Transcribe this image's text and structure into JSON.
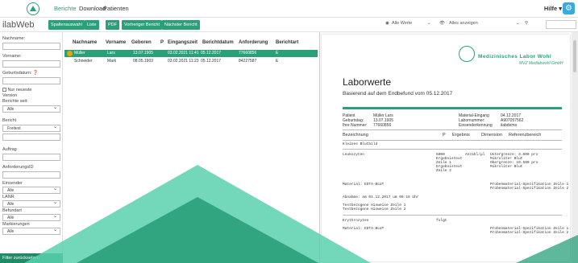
{
  "nav": {
    "items": [
      "Berichte",
      "Download",
      "Patienten"
    ],
    "help": "Hilfe"
  },
  "app": {
    "brand": "ilabWeb"
  },
  "toolbar": {
    "buttons": [
      "Spaltenauswahl",
      "Liste",
      "PDF",
      "Vorheriger Bericht",
      "Nächster Bericht"
    ],
    "values_label": "Alle Werte",
    "show_label": "Alles anzeigen"
  },
  "filters": {
    "name": "Nachname:",
    "firstname": "Vorname:",
    "birthdate": "Geburtsdatum:",
    "only_newest": "Nur neueste",
    "version": "Version",
    "reports_since": "Berichte seit:",
    "reports_since_value": "Alle",
    "report": "Bericht",
    "report_value": "Freitext",
    "order": "Auftrag",
    "order_id": "AnforderungsID",
    "sender": "Einsender",
    "sender_value": "Alle",
    "lanr": "LANR",
    "lanr_value": "Alle",
    "findings": "Befundart",
    "findings_value": "Alle",
    "markings": "Markierungen",
    "markings_value": "Alle",
    "reset": "Filter zurücksetzen"
  },
  "table": {
    "headers": [
      "Nachname",
      "Vorname",
      "Geboren",
      "P",
      "Eingangszeit",
      "Berichtdatum",
      "Anforderung",
      "Berichtart"
    ],
    "rows": [
      [
        "Müller",
        "Lars",
        "13.07.1905",
        "",
        "03.02.2021 11:41",
        "05.12.2017",
        "77660856",
        "E"
      ],
      [
        "Schneider",
        "Mark",
        "08.05.1903",
        "",
        "03.02.2021 11:23",
        "05.12.2017",
        "84227587",
        "E"
      ]
    ]
  },
  "doc": {
    "lab_name": "Medizinisches Labor Wohl",
    "lab_sub": "MVZ Medlabwohl GmbH",
    "title": "Laborwerte",
    "subtitle": "Basierend auf dem Endbefund vom 05.12.2017",
    "patient_label": "Patient",
    "patient": "Müller Lars",
    "birth_label": "Geburtstag:",
    "birth": "13.07.1905",
    "number_label": "Ihre Nummer:",
    "number": "77660856",
    "receipt_label": "Material-Eingang",
    "receipt": "04.12.2017",
    "labnr_label": "Labornummer:",
    "labnr": "A907057562",
    "sender_label": "Einsenderkennung",
    "sender": "ilabdemo",
    "cols": [
      "Bezeichnung",
      "P",
      "Ergebnis",
      "Dimension",
      "Referenzbereich"
    ],
    "section": "Kleines Blutbild",
    "leuko": "Leukozyten",
    "leuko_result": "6000\nErgebnistext\nZeile 1\nErgebnistext\nZeile 2",
    "leuko_dim": "Anzahl/µl",
    "leuko_ref": "Untergrenze: 3.000 pro\nMikroliter Blut\nObergrenze: 10.500 pro\nMikroliter Blut",
    "material1": "Material: EDTA-BLUT",
    "spec1": "Probenmaterial-Spezifikation Zeile 1\nProbenmaterial-Spezifikation Zeile 2",
    "abnahme": "Abnahme: am 01.12.2017 um 09:15 Uhr",
    "hinweis": "Testbezogene Hinweise Zeile 1\nTestbezogene Hinweise Zeile 2",
    "erythro": "Erythrozyten",
    "erythro_result": "folgt",
    "material2": "Material: EDTA-BLUT",
    "spec2": "Probenmaterial-Spezifikation Zeile 1\nProbenmaterial-Spezifikation Zeile 2"
  },
  "colors": {
    "accent": "#2aa07a",
    "selected_row": "#2aa07a",
    "decor_wave": "#4cc7a4"
  }
}
